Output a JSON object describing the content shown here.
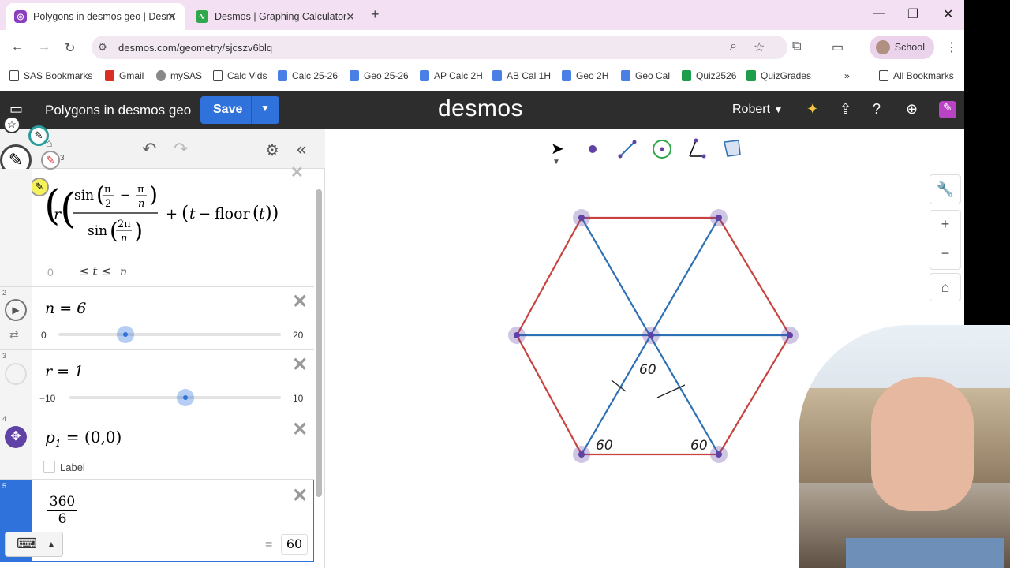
{
  "browser": {
    "tabs": [
      {
        "title": "Polygons in desmos geo | Desm",
        "active": true
      },
      {
        "title": "Desmos | Graphing Calculator",
        "active": false
      }
    ],
    "url": "desmos.com/geometry/sjcszv6blq",
    "profile": "School",
    "bookmarks": [
      "SAS Bookmarks",
      "Gmail",
      "mySAS",
      "Calc Vids",
      "Calc 25-26",
      "Geo 25-26",
      "AP Calc 2H",
      "AB Cal 1H",
      "Geo 2H",
      "Geo Cal",
      "Quiz2526",
      "QuizGrades"
    ],
    "all_bookmarks": "All Bookmarks"
  },
  "desmos": {
    "title": "Polygons in desmos geo",
    "save_label": "Save",
    "logo": "desmos",
    "user": "Robert",
    "accent": "#2f72dc"
  },
  "expressions": {
    "e1": {
      "lo": "0",
      "mid": "≤ t ≤",
      "hi": "n"
    },
    "e2": {
      "num": "2",
      "text": "n = 6",
      "min": "0",
      "max": "20",
      "value": 6
    },
    "e3": {
      "num": "3",
      "text": "r = 1",
      "min": "−10",
      "max": "10",
      "value": 1
    },
    "e4": {
      "num": "4",
      "text": "p",
      "sub": "1",
      "rest": " = (0,0)",
      "label": "Label"
    },
    "e5": {
      "num": "5",
      "numerator": "360",
      "denominator": "6",
      "result": "60"
    }
  },
  "annotations": [
    "60",
    "60",
    "60"
  ],
  "colors": {
    "red": "#c74440",
    "blue": "#2d70b3",
    "purple": "#6042a6"
  }
}
